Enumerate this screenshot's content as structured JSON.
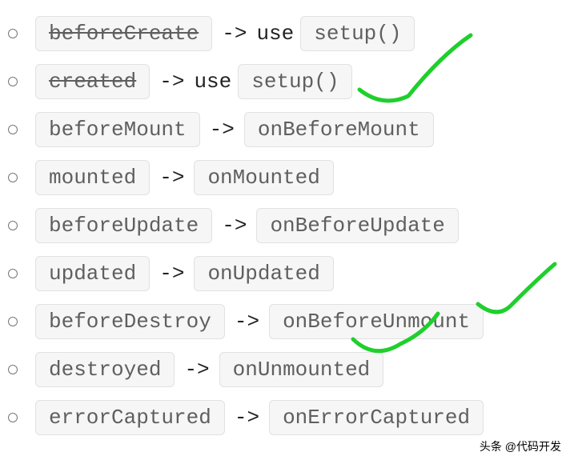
{
  "hooks": [
    {
      "from": "beforeCreate",
      "strike": true,
      "use": true,
      "to": "setup()"
    },
    {
      "from": "created",
      "strike": true,
      "use": true,
      "to": "setup()"
    },
    {
      "from": "beforeMount",
      "strike": false,
      "use": false,
      "to": "onBeforeMount"
    },
    {
      "from": "mounted",
      "strike": false,
      "use": false,
      "to": "onMounted"
    },
    {
      "from": "beforeUpdate",
      "strike": false,
      "use": false,
      "to": "onBeforeUpdate"
    },
    {
      "from": "updated",
      "strike": false,
      "use": false,
      "to": "onUpdated"
    },
    {
      "from": "beforeDestroy",
      "strike": false,
      "use": false,
      "to": "onBeforeUnmount"
    },
    {
      "from": "destroyed",
      "strike": false,
      "use": false,
      "to": "onUnmounted"
    },
    {
      "from": "errorCaptured",
      "strike": false,
      "use": false,
      "to": "onErrorCaptured"
    }
  ],
  "tokens": {
    "arrow": "->",
    "use": "use"
  },
  "watermark": "头条 @代码开发"
}
